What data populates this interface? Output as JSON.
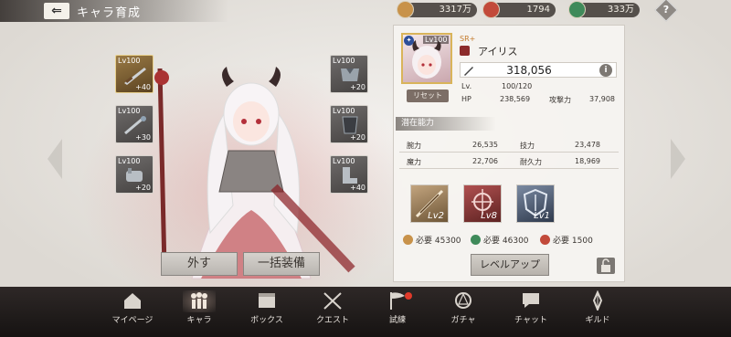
{
  "header": {
    "back_label": "⇐",
    "title": "キャラ育成"
  },
  "currencies": [
    {
      "name": "gold",
      "value": "3317万",
      "color": "#c8924a"
    },
    {
      "name": "gem",
      "value": "1794",
      "color": "#c24a3a"
    },
    {
      "name": "stamina",
      "value": "333万",
      "color": "#3f8a5a"
    }
  ],
  "help_label": "?",
  "equipment": [
    {
      "level": "Lv100",
      "plus": "+40",
      "type": "sword"
    },
    {
      "level": "Lv100",
      "plus": "+20",
      "type": "armor"
    },
    {
      "level": "Lv100",
      "plus": "+30",
      "type": "staff"
    },
    {
      "level": "Lv100",
      "plus": "+20",
      "type": "armor"
    },
    {
      "level": "Lv100",
      "plus": "+20",
      "type": "gauntlet"
    },
    {
      "level": "Lv100",
      "plus": "+40",
      "type": "boots"
    }
  ],
  "actions": {
    "unequip": "外す",
    "equip_all": "一括装備"
  },
  "character": {
    "portrait_level": "Lv100",
    "rarity": "SR+",
    "name": "アイリス",
    "power": "318,056",
    "info": "i",
    "reset": "リセット",
    "lv_label": "Lv.",
    "lv_value": "100/120",
    "hp_label": "HP",
    "hp_value": "238,569",
    "atk_label": "攻撃力",
    "atk_value": "37,908"
  },
  "potential": {
    "title": "潜在能力",
    "stats": [
      {
        "label": "腕力",
        "value": "26,535"
      },
      {
        "label": "技力",
        "value": "23,478"
      },
      {
        "label": "魔力",
        "value": "22,706"
      },
      {
        "label": "耐久力",
        "value": "18,969"
      }
    ]
  },
  "skills": [
    {
      "level": "Lv2",
      "color": "#9a7f5c"
    },
    {
      "level": "Lv8",
      "color": "#8a3a38"
    },
    {
      "level": "Lv1",
      "color": "#5c6b84"
    }
  ],
  "costs": [
    {
      "label": "必要",
      "value": "45300",
      "color": "#c8924a"
    },
    {
      "label": "必要",
      "value": "46300",
      "color": "#3f8a5a"
    },
    {
      "label": "必要",
      "value": "1500",
      "color": "#c24a3a"
    }
  ],
  "level_up": "レベルアップ",
  "bottom_nav": [
    {
      "label": "マイページ",
      "icon": "home-icon"
    },
    {
      "label": "キャラ",
      "icon": "characters-icon"
    },
    {
      "label": "ボックス",
      "icon": "box-icon"
    },
    {
      "label": "クエスト",
      "icon": "crossed-swords-icon"
    },
    {
      "label": "試練",
      "icon": "flag-icon"
    },
    {
      "label": "ガチャ",
      "icon": "gacha-icon"
    },
    {
      "label": "チャット",
      "icon": "chat-icon"
    },
    {
      "label": "ギルド",
      "icon": "guild-icon"
    }
  ]
}
